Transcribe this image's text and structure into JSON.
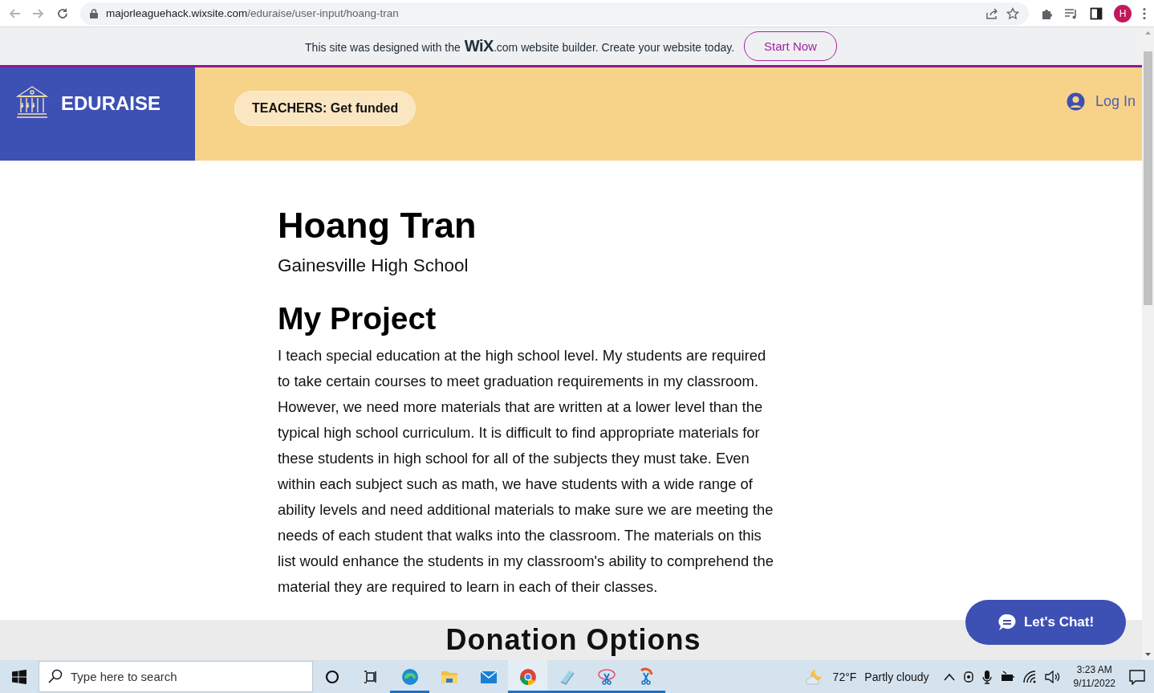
{
  "browser": {
    "url_host": "majorleaguehack.wixsite.com",
    "url_path": "/eduraise/user-input/hoang-tran",
    "profile_initial": "H"
  },
  "wix_banner": {
    "text_before": "This site was designed with the",
    "logo": "WiX",
    "text_after": ".com website builder. Create your website today.",
    "button": "Start Now"
  },
  "header": {
    "brand": "EDURAISE",
    "cta": "TEACHERS: Get funded",
    "login": "Log In"
  },
  "profile": {
    "name": "Hoang Tran",
    "school": "Gainesville High School",
    "section_title": "My Project",
    "description_lines": [
      "I teach special education at the high school level. My students are required",
      "to take certain courses to meet graduation requirements in my classroom.",
      "However, we need more materials that are written at a lower level than the",
      "typical high school curriculum. It is difficult to find appropriate materials for",
      "these students in high school for all of the subjects they must take. Even",
      "within each subject such as math, we have students with a wide range of",
      "ability levels and need additional materials to make sure we are meeting the",
      "needs of each student that walks into the classroom. The materials on this",
      "list would enhance the students in my classroom's ability to comprehend the",
      "material they are required to learn in each of their classes."
    ]
  },
  "donation": {
    "title": "Donation Options"
  },
  "chat": {
    "label": "Let's Chat!"
  },
  "taskbar": {
    "search_placeholder": "Type here to search",
    "apps": [
      {
        "kind": "edge",
        "running": true,
        "selected": false
      },
      {
        "kind": "folder",
        "running": false,
        "selected": false
      },
      {
        "kind": "mail",
        "running": false,
        "selected": false
      },
      {
        "kind": "chrome",
        "running": true,
        "selected": true
      },
      {
        "kind": "notebook",
        "running": true,
        "selected": false
      },
      {
        "kind": "snip",
        "running": true,
        "selected": false
      },
      {
        "kind": "scissors",
        "running": true,
        "selected": false
      }
    ],
    "temperature": "72°F",
    "weather": "Partly cloudy",
    "time": "3:23 AM",
    "date": "9/11/2022"
  }
}
